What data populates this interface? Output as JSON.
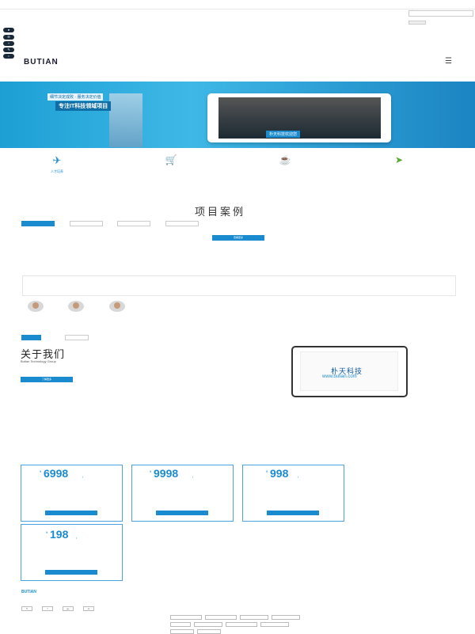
{
  "header": {
    "top_note": "",
    "search_placeholder": "",
    "top_link_1": "",
    "top_link_2": "",
    "btn_login": "",
    "btn_register": "",
    "side_items": [
      "",
      "",
      "",
      "",
      ""
    ],
    "logo_text": "BUTIAN",
    "logo_sub": "",
    "menu_icon": "hamburger-icon"
  },
  "banner": {
    "tag": "细节决定成败 · 服务决定价值",
    "title": "专注IT科技领域项目",
    "line1": "",
    "line2": "",
    "tablet_top": "",
    "tablet_caption": "朴天科技欢迎您"
  },
  "features": [
    {
      "icon": "plane-icon",
      "title": "人才培养",
      "color": "#1b8bd0",
      "desc": ""
    },
    {
      "icon": "cart-icon",
      "title": "",
      "color": "#c93fa0",
      "desc": ""
    },
    {
      "icon": "cup-icon",
      "title": "",
      "color": "#e07a1a",
      "desc": ""
    },
    {
      "icon": "rocket-icon",
      "title": "",
      "color": "#5aa832",
      "desc": ""
    }
  ],
  "projects": {
    "title": "项目案例",
    "tabs": [
      "",
      "",
      "",
      ""
    ],
    "more": "查看更多"
  },
  "about": {
    "tabs": [
      "",
      ""
    ],
    "title": "关于我们",
    "en": "Butian Technology Group",
    "desc": "",
    "button": "了解更多",
    "ipad_title": "朴天科技",
    "ipad_url": "www.butian.com"
  },
  "pricing": [
    {
      "price": "6998",
      "unit": "/",
      "name": "",
      "lines": [
        "",
        "",
        ""
      ],
      "button": ""
    },
    {
      "price": "9998",
      "unit": "/",
      "name": "",
      "lines": [
        "",
        "",
        ""
      ],
      "button": ""
    },
    {
      "price": "998",
      "unit": "/",
      "name": "",
      "lines": [
        "",
        "",
        ""
      ],
      "button": ""
    },
    {
      "price": "198",
      "unit": "/",
      "name": "",
      "lines": [
        "",
        "",
        ""
      ],
      "button": ""
    }
  ],
  "footer": {
    "logo": "BUTIAN",
    "desc": "",
    "social": [
      "",
      "",
      "",
      ""
    ],
    "head1": "",
    "links": [
      "",
      "",
      ""
    ],
    "head2": "",
    "tags": [
      "",
      "",
      "",
      "",
      "",
      "",
      "",
      "",
      "",
      ""
    ]
  },
  "colors": {
    "accent": "#1b8bd0",
    "banner": "#3eb8e6"
  }
}
